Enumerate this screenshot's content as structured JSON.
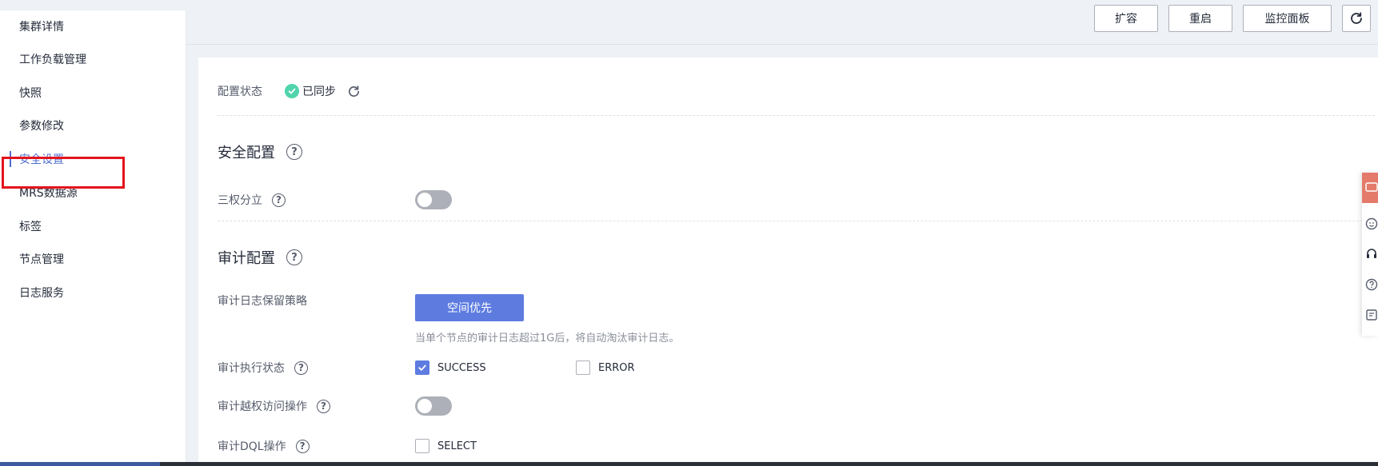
{
  "sidebar": {
    "items": [
      {
        "label": "集群详情"
      },
      {
        "label": "工作负载管理"
      },
      {
        "label": "快照"
      },
      {
        "label": "参数修改"
      },
      {
        "label": "安全设置"
      },
      {
        "label": "MRS数据源"
      },
      {
        "label": "标签"
      },
      {
        "label": "节点管理"
      },
      {
        "label": "日志服务"
      }
    ],
    "active_item": "安全设置"
  },
  "toolbar": {
    "expand_label": "扩容",
    "restart_label": "重启",
    "monitor_label": "监控面板"
  },
  "config_status": {
    "label": "配置状态",
    "value": "已同步"
  },
  "security_section": {
    "title": "安全配置",
    "separation_label": "三权分立",
    "separation_enabled": false
  },
  "audit_section": {
    "title": "审计配置",
    "retention_label": "审计日志保留策略",
    "retention_button": "空间优先",
    "retention_hint": "当单个节点的审计日志超过1G后，将自动淘汰审计日志。",
    "exec_status_label": "审计执行状态",
    "exec_success_label": "SUCCESS",
    "exec_success_checked": true,
    "exec_error_label": "ERROR",
    "exec_error_checked": false,
    "privilege_label": "审计越权访问操作",
    "privilege_enabled": false,
    "dql_label": "审计DQL操作",
    "dql_select_label": "SELECT",
    "dql_select_checked": false
  },
  "colors": {
    "accent": "#5e7ce0",
    "sync_green": "#50d4ab",
    "highlight_red": "#e3141c"
  }
}
